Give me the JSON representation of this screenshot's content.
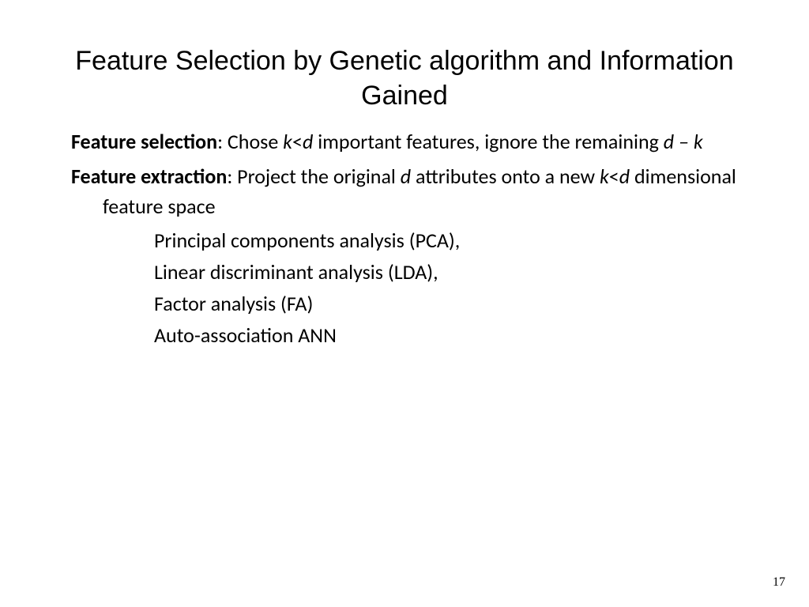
{
  "title": "Feature Selection by Genetic algorithm and Information Gained",
  "para1": {
    "bold": "Feature selection",
    "t1": ": Chose ",
    "i1": "k",
    "t2": "<",
    "i2": "d",
    "t3": " important features, ignore the remaining ",
    "i3": "d – k"
  },
  "para2": {
    "bold": "Feature extraction",
    "t1": ": Project the original ",
    "i1": "d",
    "t2": " attributes onto a new ",
    "i2": "k",
    "t3": "<",
    "i3": "d",
    "t4": " dimensional feature space"
  },
  "items": {
    "a": "Principal components analysis (PCA),",
    "b": "Linear discriminant analysis (LDA),",
    "c": "Factor analysis (FA)",
    "d": "Auto-association ANN"
  },
  "pageNumber": "17"
}
